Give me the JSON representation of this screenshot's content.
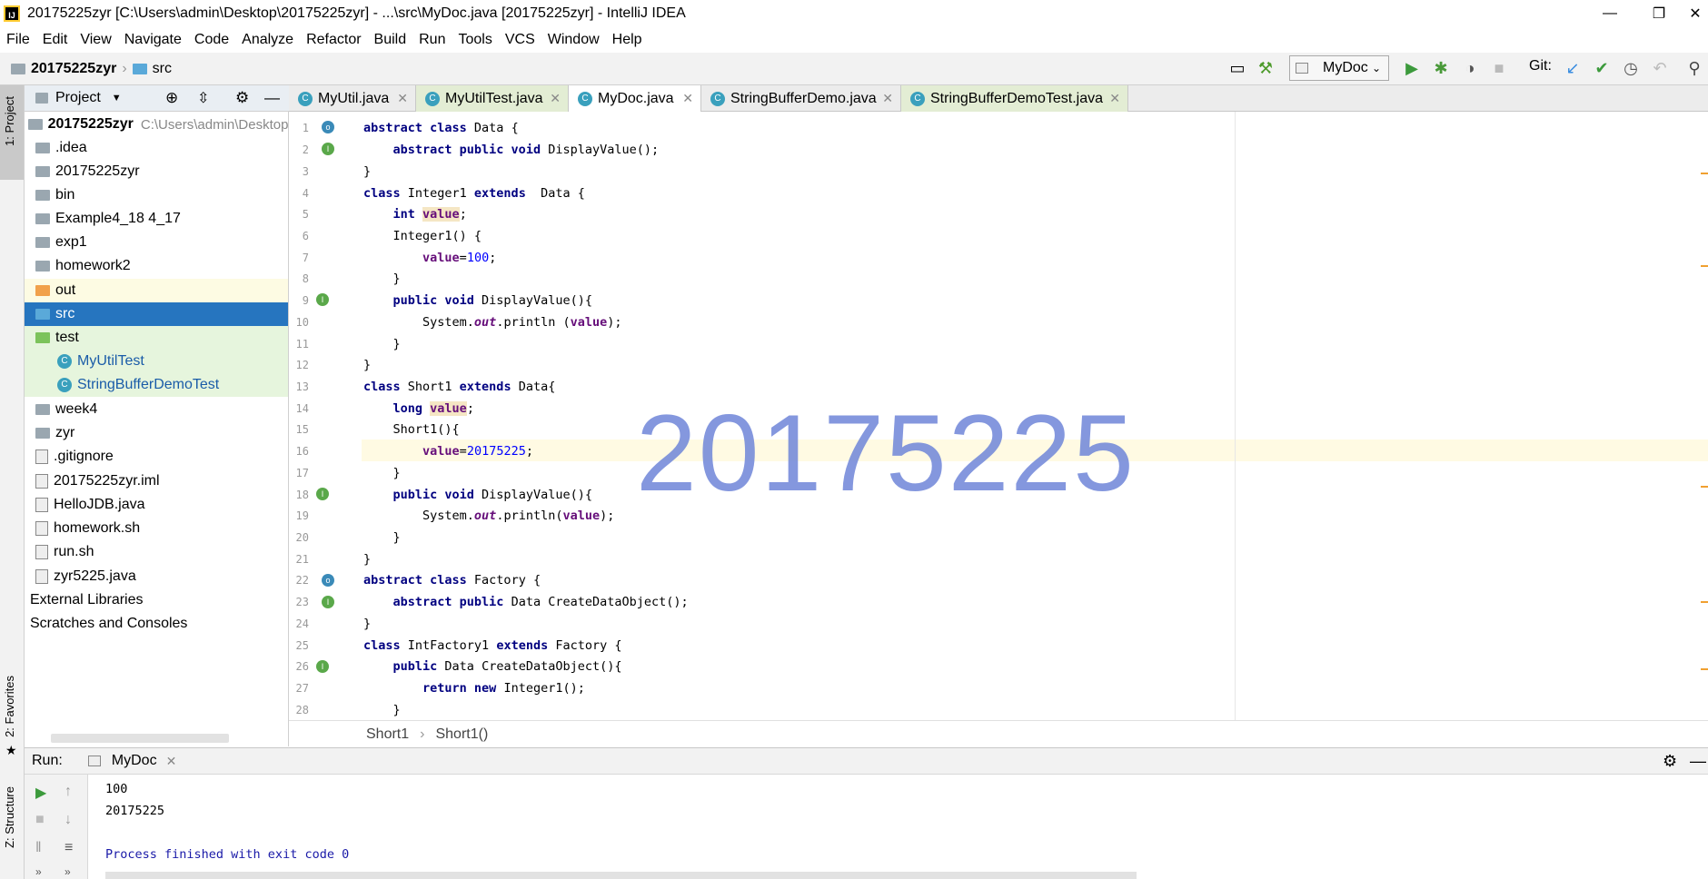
{
  "window": {
    "title": "20175225zyr [C:\\Users\\admin\\Desktop\\20175225zyr] - ...\\src\\MyDoc.java [20175225zyr] - IntelliJ IDEA"
  },
  "menu": [
    "File",
    "Edit",
    "View",
    "Navigate",
    "Code",
    "Analyze",
    "Refactor",
    "Build",
    "Run",
    "Tools",
    "VCS",
    "Window",
    "Help"
  ],
  "nav": {
    "project": "20175225zyr",
    "folder": "src",
    "run_config": "MyDoc",
    "git_label": "Git:"
  },
  "strip": {
    "project": "1: Project",
    "favorites": "2: Favorites",
    "structure": "Z: Structure"
  },
  "project_panel": {
    "title": "Project",
    "root": "20175225zyr",
    "root_path": "C:\\Users\\admin\\Desktop\\",
    "items": [
      ".idea",
      "20175225zyr",
      "bin",
      "Example4_18 4_17",
      "exp1",
      "homework2",
      "out",
      "src",
      "test",
      "MyUtilTest",
      "StringBufferDemoTest",
      "week4",
      "zyr",
      ".gitignore",
      "20175225zyr.iml",
      "HelloJDB.java",
      "homework.sh",
      "run.sh",
      "zyr5225.java",
      "External Libraries",
      "Scratches and Consoles"
    ]
  },
  "tabs": [
    "MyUtil.java",
    "MyUtilTest.java",
    "MyDoc.java",
    "StringBufferDemo.java",
    "StringBufferDemoTest.java"
  ],
  "line_numbers": [
    "1",
    "2",
    "3",
    "4",
    "5",
    "6",
    "7",
    "8",
    "9",
    "10",
    "11",
    "12",
    "13",
    "14",
    "15",
    "16",
    "17",
    "18",
    "19",
    "20",
    "21",
    "22",
    "23",
    "24",
    "25",
    "26",
    "27",
    "28"
  ],
  "breadcrumb": {
    "a": "Short1",
    "sep": "›",
    "b": "Short1()"
  },
  "watermark": "20175225",
  "run": {
    "label": "Run:",
    "config": "MyDoc",
    "output": [
      "100",
      "20175225",
      "",
      "Process finished with exit code 0"
    ]
  }
}
